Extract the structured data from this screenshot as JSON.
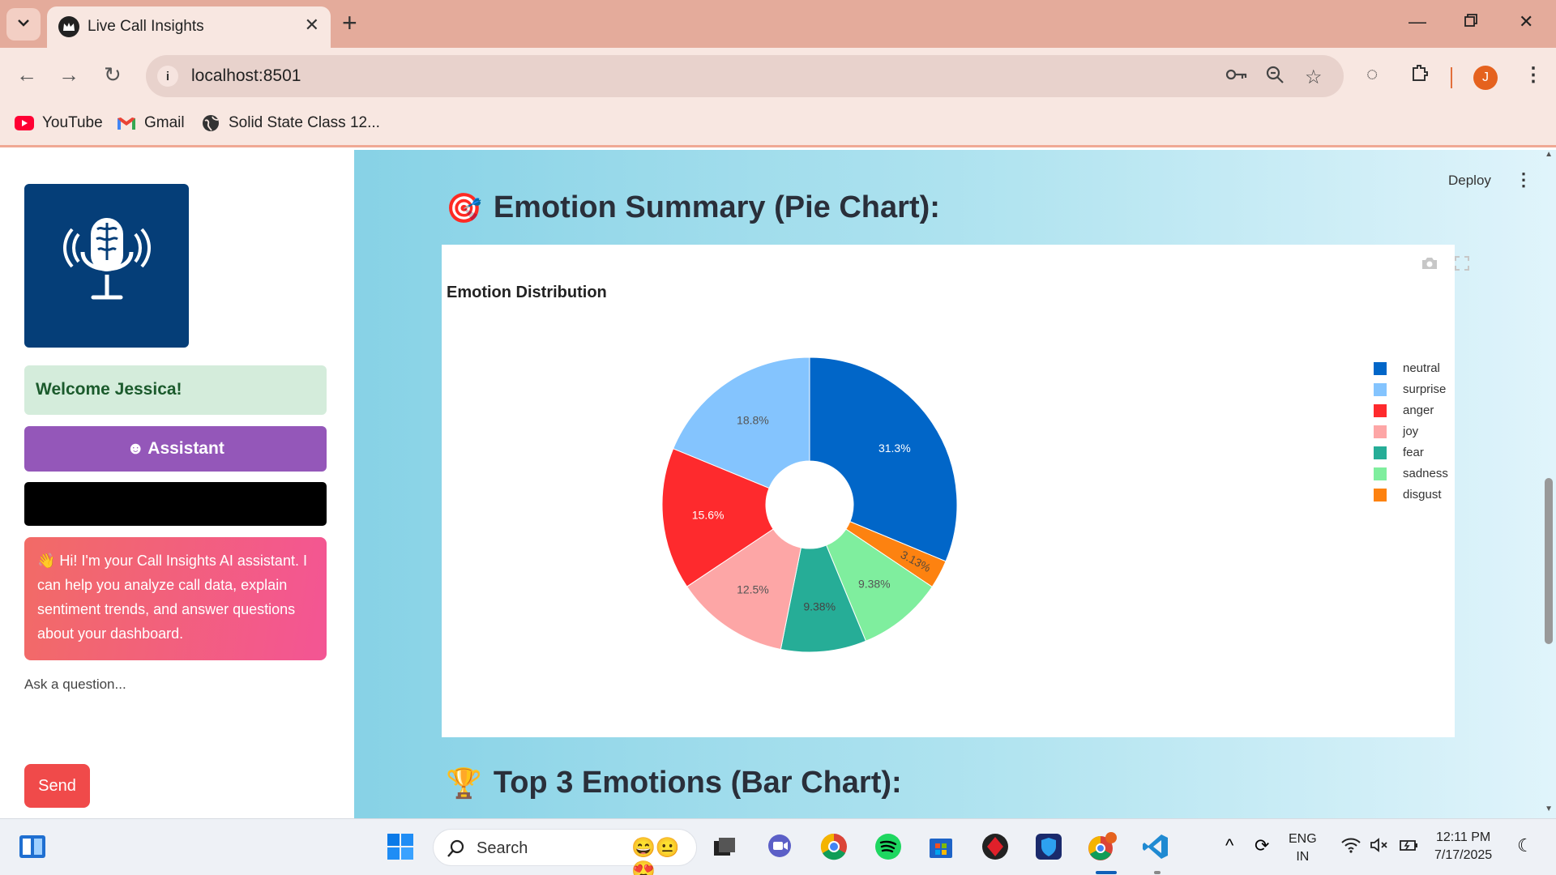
{
  "browser": {
    "tab_title": "Live Call Insights",
    "url": "localhost:8501",
    "avatar_letter": "J",
    "bookmarks": [
      {
        "label": "YouTube",
        "icon": "youtube-icon"
      },
      {
        "label": "Gmail",
        "icon": "gmail-icon"
      },
      {
        "label": "Solid State Class 12...",
        "icon": "globe-icon"
      }
    ]
  },
  "sidebar": {
    "logo_icon": "brain-microphone-icon",
    "welcome": "Welcome Jessica!",
    "assistant_label": "Assistant",
    "assistant_message": "👋 Hi! I'm your Call Insights AI assistant. I can help you analyze call data, explain sentiment trends, and answer questions about your dashboard.",
    "ask_label": "Ask a question...",
    "send_label": "Send"
  },
  "main": {
    "deploy_label": "Deploy",
    "section1_title": "Emotion Summary (Pie Chart):",
    "section1_icon": "🎯",
    "section2_title": "Top 3 Emotions (Bar Chart):",
    "section2_icon": "🏆"
  },
  "chart_data": {
    "type": "pie",
    "title": "Emotion Distribution",
    "hole": true,
    "legend_position": "right",
    "categories": [
      "neutral",
      "disgust",
      "sadness",
      "fear",
      "joy",
      "anger",
      "surprise"
    ],
    "values": [
      31.3,
      3.13,
      9.38,
      9.38,
      12.5,
      15.6,
      18.8
    ],
    "labels": [
      "31.3%",
      "3.13%",
      "9.38%",
      "9.38%",
      "12.5%",
      "15.6%",
      "18.8%"
    ],
    "colors": [
      "#0166c8",
      "#fd8210",
      "#7fee9e",
      "#26ad97",
      "#fda6a6",
      "#fe2a2d",
      "#84c4fe"
    ],
    "label_colors": [
      "#ffffff",
      "#5a4a3a",
      "#555555",
      "#444444",
      "#555555",
      "#ffffff",
      "#555555"
    ],
    "legend_order": [
      "neutral",
      "surprise",
      "anger",
      "joy",
      "fear",
      "sadness",
      "disgust"
    ]
  },
  "taskbar": {
    "search_placeholder": "Search",
    "lang_line1": "ENG",
    "lang_line2": "IN",
    "time": "12:11 PM",
    "date": "7/17/2025"
  }
}
